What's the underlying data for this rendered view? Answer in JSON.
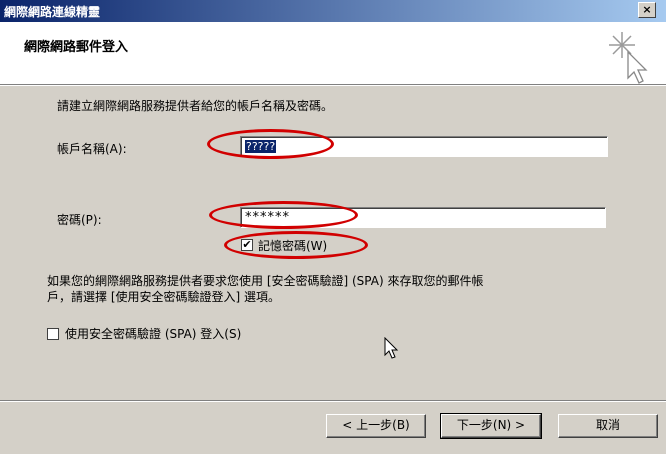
{
  "window": {
    "title": "網際網路連線精靈",
    "close_label": "×"
  },
  "header": {
    "title": "網際網路郵件登入"
  },
  "intro": "請建立網際網路服務提供者給您的帳戶名稱及密碼。",
  "account": {
    "label": "帳戶名稱(A):",
    "value": "?????"
  },
  "password": {
    "label": "密碼(P):",
    "value": "******"
  },
  "remember": {
    "label": "記憶密碼(W)",
    "checked": true,
    "mark": "✔"
  },
  "spa_note": {
    "line1": "如果您的網際網路服務提供者要求您使用 [安全密碼驗證] (SPA) 來存取您的郵件帳",
    "line2": "戶，請選擇 [使用安全密碼驗證登入] 選項。"
  },
  "spa": {
    "label": "使用安全密碼驗證 (SPA) 登入(S)",
    "checked": false
  },
  "buttons": {
    "back": "< 上一步(B)",
    "next": "下一步(N) >",
    "cancel": "取消"
  },
  "colors": {
    "annotation": "#d10000",
    "titlebar_start": "#0a246a",
    "titlebar_end": "#a6caf0"
  }
}
